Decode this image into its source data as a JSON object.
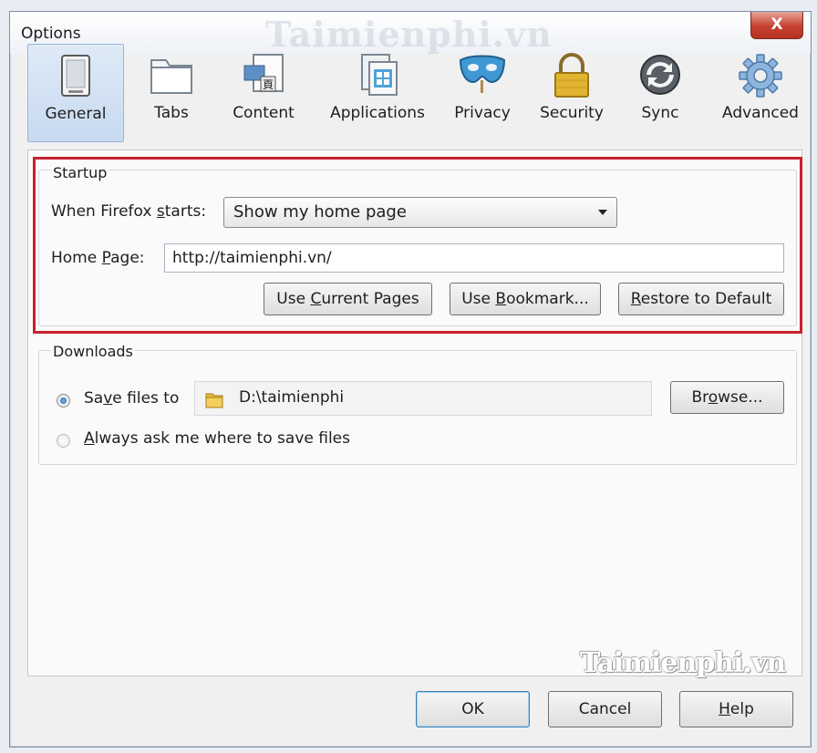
{
  "window": {
    "title": "Options",
    "watermark": "Taimienphi.vn",
    "close_label": "X"
  },
  "toolbar": {
    "tabs": [
      {
        "label": "General",
        "icon": "general-icon",
        "selected": true
      },
      {
        "label": "Tabs",
        "icon": "tabs-icon"
      },
      {
        "label": "Content",
        "icon": "content-icon"
      },
      {
        "label": "Applications",
        "icon": "applications-icon"
      },
      {
        "label": "Privacy",
        "icon": "privacy-mask-icon"
      },
      {
        "label": "Security",
        "icon": "padlock-icon"
      },
      {
        "label": "Sync",
        "icon": "sync-icon"
      },
      {
        "label": "Advanced",
        "icon": "gear-icon"
      }
    ]
  },
  "startup": {
    "group_label": "Startup",
    "when_starts_label": "When Firefox starts:",
    "when_starts_value": "Show my home page",
    "home_page_label": "Home Page:",
    "home_page_value": "http://taimienphi.vn/",
    "use_current_label": "Use Current Pages",
    "use_bookmark_label": "Use Bookmark...",
    "restore_default_label": "Restore to Default"
  },
  "downloads": {
    "group_label": "Downloads",
    "save_files_label": "Save files to",
    "save_path": "D:\\taimienphi",
    "browse_label": "Browse...",
    "always_ask_label": "Always ask me where to save files",
    "selected_option": "save_files"
  },
  "footer": {
    "watermark": "Taimienphi.vn",
    "ok_label": "OK",
    "cancel_label": "Cancel",
    "help_label": "Help"
  },
  "colors": {
    "highlight": "#c8202e",
    "selected_tab": "#c7daf0"
  }
}
